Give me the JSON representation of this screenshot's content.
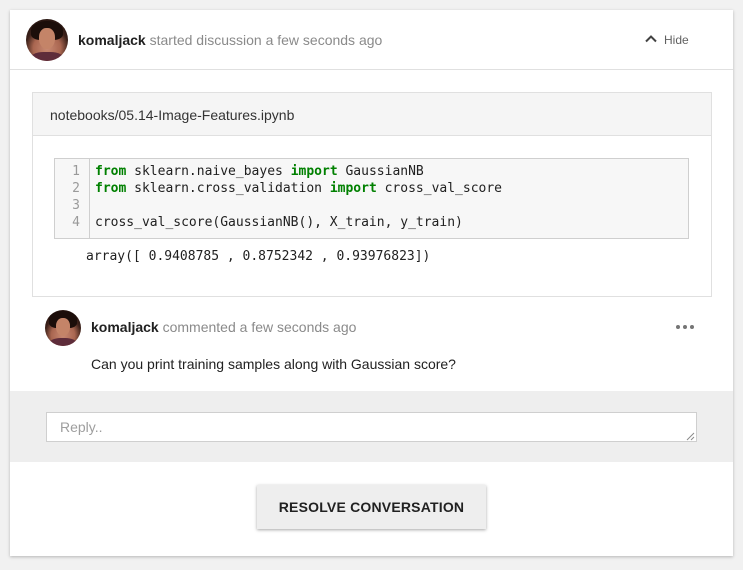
{
  "discussion": {
    "author": "komaljack",
    "action": "started discussion",
    "time": "a few seconds ago",
    "hide_label": "Hide",
    "hide_icon": "chevron-up-icon"
  },
  "file": {
    "path": "notebooks/05.14-Image-Features.ipynb",
    "code_lines": [
      {
        "num": "1",
        "kw1": "from",
        "mid": " sklearn.naive_bayes ",
        "kw2": "import",
        "rest": " GaussianNB"
      },
      {
        "num": "2",
        "kw1": "from",
        "mid": " sklearn.cross_validation ",
        "kw2": "import",
        "rest": " cross_val_score"
      },
      {
        "num": "3",
        "kw1": "",
        "mid": "",
        "kw2": "",
        "rest": ""
      },
      {
        "num": "4",
        "kw1": "",
        "mid": "cross_val_score(GaussianNB(), X_train, y_train)",
        "kw2": "",
        "rest": ""
      }
    ],
    "output": "array([ 0.9408785 , 0.8752342 , 0.93976823])"
  },
  "comment": {
    "author": "komaljack",
    "action": "commented",
    "time": "a few seconds ago",
    "body": "Can you print training samples along with Gaussian score?",
    "more_icon": "more-horizontal-icon"
  },
  "reply": {
    "placeholder": "Reply.."
  },
  "resolve": {
    "label": "RESOLVE CONVERSATION"
  },
  "colors": {
    "keyword": "#008000",
    "muted": "#8a8a8a",
    "card": "#ffffff",
    "page": "#f1f1f1"
  }
}
